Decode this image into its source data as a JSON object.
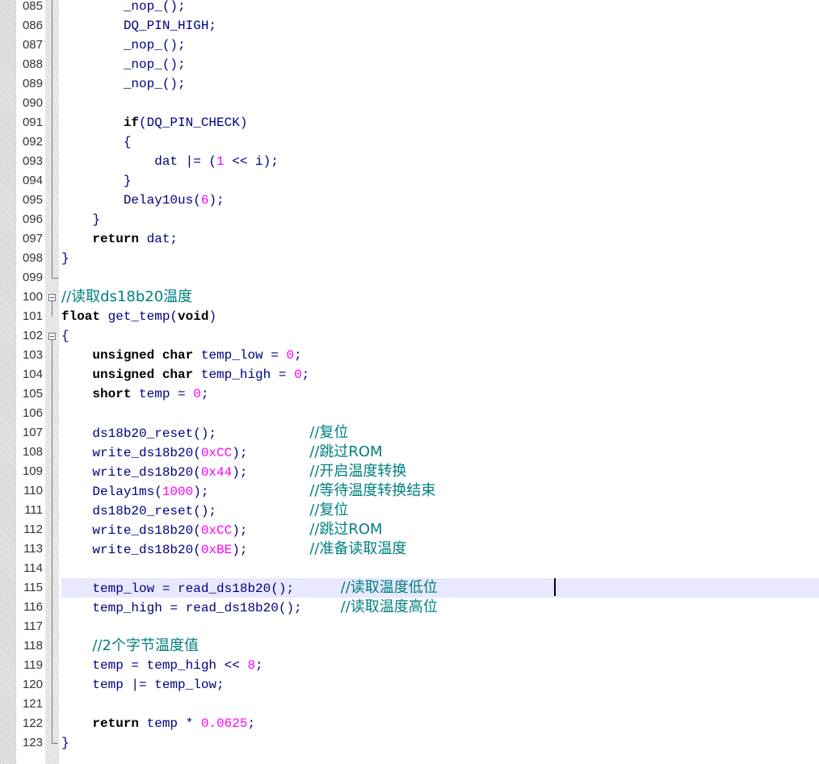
{
  "editor": {
    "current_line": "115",
    "lines": [
      {
        "num": "085",
        "text": "        _nop_();"
      },
      {
        "num": "086",
        "text": "        DQ_PIN_HIGH;"
      },
      {
        "num": "087",
        "text": "        _nop_();"
      },
      {
        "num": "088",
        "text": "        _nop_();"
      },
      {
        "num": "089",
        "text": "        _nop_();"
      },
      {
        "num": "090",
        "text": ""
      },
      {
        "num": "091",
        "text": "        if(DQ_PIN_CHECK)"
      },
      {
        "num": "092",
        "text": "        {"
      },
      {
        "num": "093",
        "text": "            dat |= (1 << i);"
      },
      {
        "num": "094",
        "text": "        }"
      },
      {
        "num": "095",
        "text": "        Delay10us(6);"
      },
      {
        "num": "096",
        "text": "    }"
      },
      {
        "num": "097",
        "text": "    return dat;"
      },
      {
        "num": "098",
        "text": "}"
      },
      {
        "num": "099",
        "text": ""
      },
      {
        "num": "100",
        "text": "//读取ds18b20温度"
      },
      {
        "num": "101",
        "text": "float get_temp(void)"
      },
      {
        "num": "102",
        "text": "{"
      },
      {
        "num": "103",
        "text": "    unsigned char temp_low = 0;"
      },
      {
        "num": "104",
        "text": "    unsigned char temp_high = 0;"
      },
      {
        "num": "105",
        "text": "    short temp = 0;"
      },
      {
        "num": "106",
        "text": ""
      },
      {
        "num": "107",
        "text": "    ds18b20_reset();            //复位"
      },
      {
        "num": "108",
        "text": "    write_ds18b20(0xCC);        //跳过ROM"
      },
      {
        "num": "109",
        "text": "    write_ds18b20(0x44);        //开启温度转换"
      },
      {
        "num": "110",
        "text": "    Delay1ms(1000);             //等待温度转换结束"
      },
      {
        "num": "111",
        "text": "    ds18b20_reset();            //复位"
      },
      {
        "num": "112",
        "text": "    write_ds18b20(0xCC);        //跳过ROM"
      },
      {
        "num": "113",
        "text": "    write_ds18b20(0xBE);        //准备读取温度"
      },
      {
        "num": "114",
        "text": ""
      },
      {
        "num": "115",
        "text": "    temp_low = read_ds18b20();      //读取温度低位"
      },
      {
        "num": "116",
        "text": "    temp_high = read_ds18b20();     //读取温度高位"
      },
      {
        "num": "117",
        "text": ""
      },
      {
        "num": "118",
        "text": "    //2个字节温度值"
      },
      {
        "num": "119",
        "text": "    temp = temp_high << 8;"
      },
      {
        "num": "120",
        "text": "    temp |= temp_low;"
      },
      {
        "num": "121",
        "text": ""
      },
      {
        "num": "122",
        "text": "    return temp * 0.0625;"
      },
      {
        "num": "123",
        "text": "}"
      }
    ]
  },
  "colors": {
    "keyword": "#000000",
    "identifier": "#000080",
    "number": "#ff00ff",
    "comment": "#008080",
    "current_line_bg": "#e8e8ff"
  }
}
